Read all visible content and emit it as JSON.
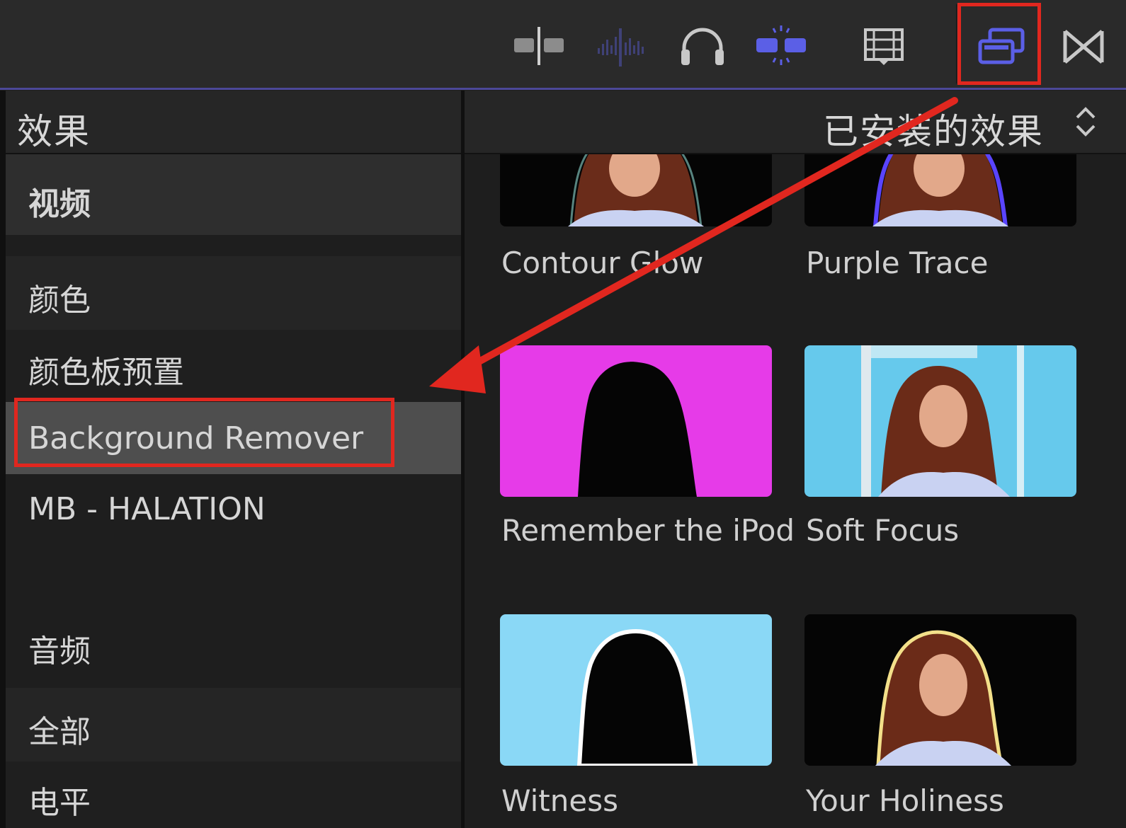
{
  "toolbar": {
    "buttons": [
      {
        "name": "clip-split-icon",
        "active": false
      },
      {
        "name": "audio-waveform-icon",
        "active": false
      },
      {
        "name": "headphones-icon",
        "active": false
      },
      {
        "name": "snapping-icon",
        "active": true
      },
      {
        "name": "clip-appearance-icon",
        "active": false
      },
      {
        "name": "effects-browser-icon",
        "active": true,
        "highlighted": true
      },
      {
        "name": "transitions-browser-icon",
        "active": false
      }
    ]
  },
  "sidebar": {
    "title": "效果",
    "items": [
      {
        "label": "视频",
        "bold": true,
        "selected": false
      },
      {
        "label": "颜色",
        "bold": false,
        "selected": false
      },
      {
        "label": "颜色板预置",
        "bold": false,
        "selected": false
      },
      {
        "label": "Background Remover",
        "bold": false,
        "selected": true,
        "highlighted": true
      },
      {
        "label": "MB - HALATION",
        "bold": false,
        "selected": false
      },
      {
        "label": "音频",
        "bold": false,
        "selected": false
      },
      {
        "label": "全部",
        "bold": false,
        "selected": false
      },
      {
        "label": "电平",
        "bold": false,
        "selected": false
      }
    ]
  },
  "browser": {
    "filter_label": "已安装的效果",
    "tiles": [
      {
        "label": "Contour Glow"
      },
      {
        "label": "Purple Trace"
      },
      {
        "label": "Remember the iPod"
      },
      {
        "label": "Soft Focus"
      },
      {
        "label": "Witness"
      },
      {
        "label": "Your Holiness"
      }
    ]
  },
  "colors": {
    "accent": "#4c4898",
    "active_icon": "#5b5fe6",
    "annotation_red": "#e1271f",
    "magenta_bg": "#e63be8",
    "sky_bg": "#66c9ec",
    "light_blue_bg": "#8ad8f6"
  }
}
